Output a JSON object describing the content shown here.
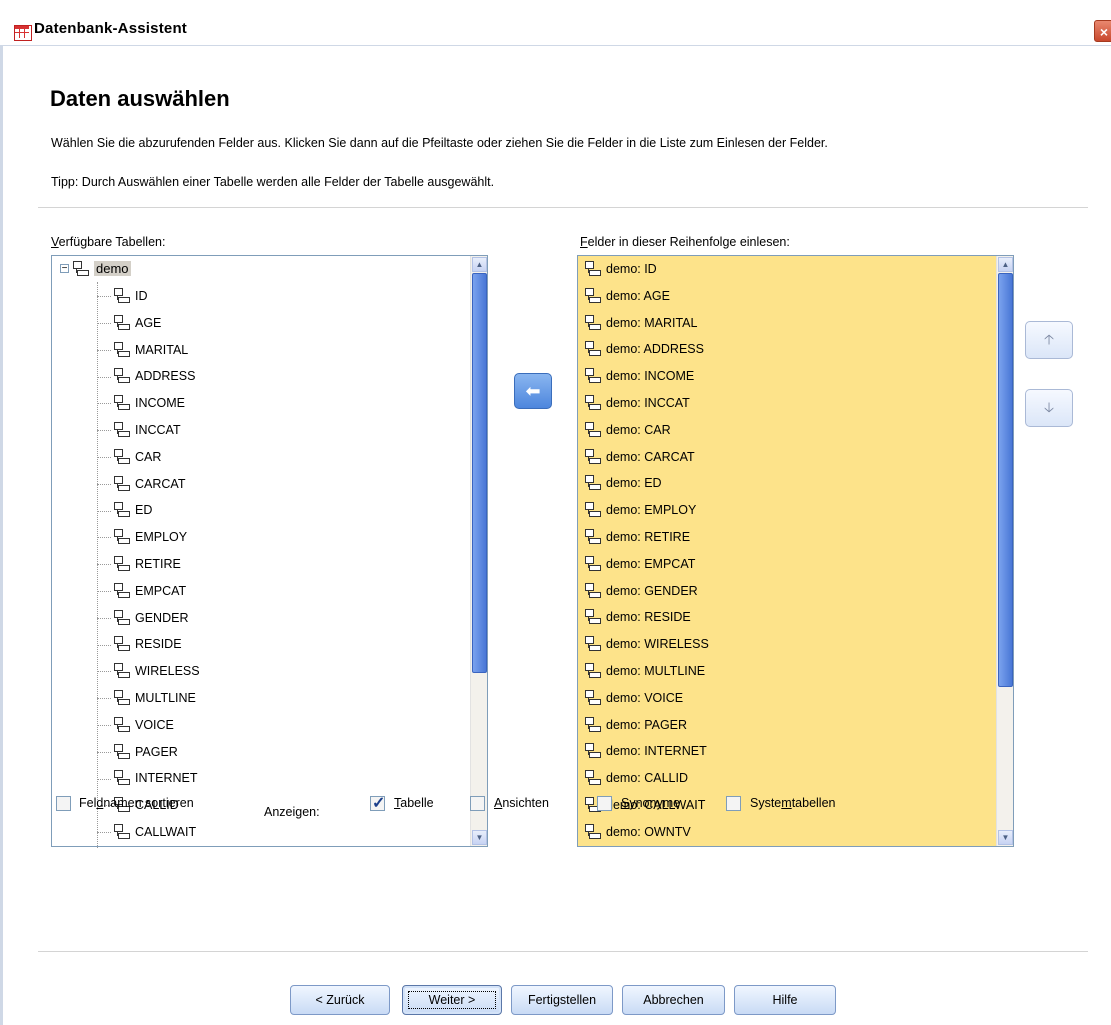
{
  "window": {
    "title": "Datenbank-Assistent",
    "close_glyph": "×"
  },
  "page": {
    "heading": "Daten auswählen",
    "description": "Wählen Sie die abzurufenden Felder aus. Klicken Sie dann auf die Pfeiltaste oder ziehen Sie die Felder in die Liste zum Einlesen der Felder.",
    "tip": "Tipp: Durch Auswählen einer Tabelle werden alle Felder der Tabelle ausgewählt."
  },
  "available": {
    "label_u": "V",
    "label_rest": "erfügbare Tabellen:",
    "table_name": "demo",
    "expander_glyph": "−",
    "fields": [
      "ID",
      "AGE",
      "MARITAL",
      "ADDRESS",
      "INCOME",
      "INCCAT",
      "CAR",
      "CARCAT",
      "ED",
      "EMPLOY",
      "RETIRE",
      "EMPCAT",
      "GENDER",
      "RESIDE",
      "WIRELESS",
      "MULTLINE",
      "VOICE",
      "PAGER",
      "INTERNET",
      "CALLID",
      "CALLWAIT"
    ]
  },
  "selected": {
    "label_u": "F",
    "label_rest": "elder in dieser Reihenfolge einlesen:",
    "fields": [
      "demo: ID",
      "demo: AGE",
      "demo: MARITAL",
      "demo: ADDRESS",
      "demo: INCOME",
      "demo: INCCAT",
      "demo: CAR",
      "demo: CARCAT",
      "demo: ED",
      "demo: EMPLOY",
      "demo: RETIRE",
      "demo: EMPCAT",
      "demo: GENDER",
      "demo: RESIDE",
      "demo: WIRELESS",
      "demo: MULTLINE",
      "demo: VOICE",
      "demo: PAGER",
      "demo: INTERNET",
      "demo: CALLID",
      "demo: CALLWAIT",
      "demo: OWNTV"
    ]
  },
  "arrows": {
    "move_left": "⬅",
    "move_up": "🡡",
    "move_down": "🡣",
    "scroll_up": "▲",
    "scroll_down": "▼"
  },
  "options": {
    "sort_label_pre": "Fel",
    "sort_label_u": "d",
    "sort_label_post": "namen sortieren",
    "sort_checked": false,
    "show_label": "Anzeigen:",
    "table_label_u": "T",
    "table_label_rest": "abelle",
    "table_checked": true,
    "views_label_u": "A",
    "views_label_rest": "nsichten",
    "views_checked": false,
    "synonyms_label_u": "S",
    "synonyms_label_rest": "ynonyme",
    "synonyms_checked": false,
    "systables_label_pre": "Syste",
    "systables_label_u": "m",
    "systables_label_post": "tabellen",
    "systables_checked": false
  },
  "buttons": {
    "back": "< Zurück",
    "next": "Weiter >",
    "finish": "Fertigstellen",
    "cancel": "Abbrechen",
    "help": "Hilfe"
  },
  "colors": {
    "selected_list_bg": "#fde38a",
    "scroll_thumb": "#4977d6",
    "close_button": "#c8482d"
  }
}
